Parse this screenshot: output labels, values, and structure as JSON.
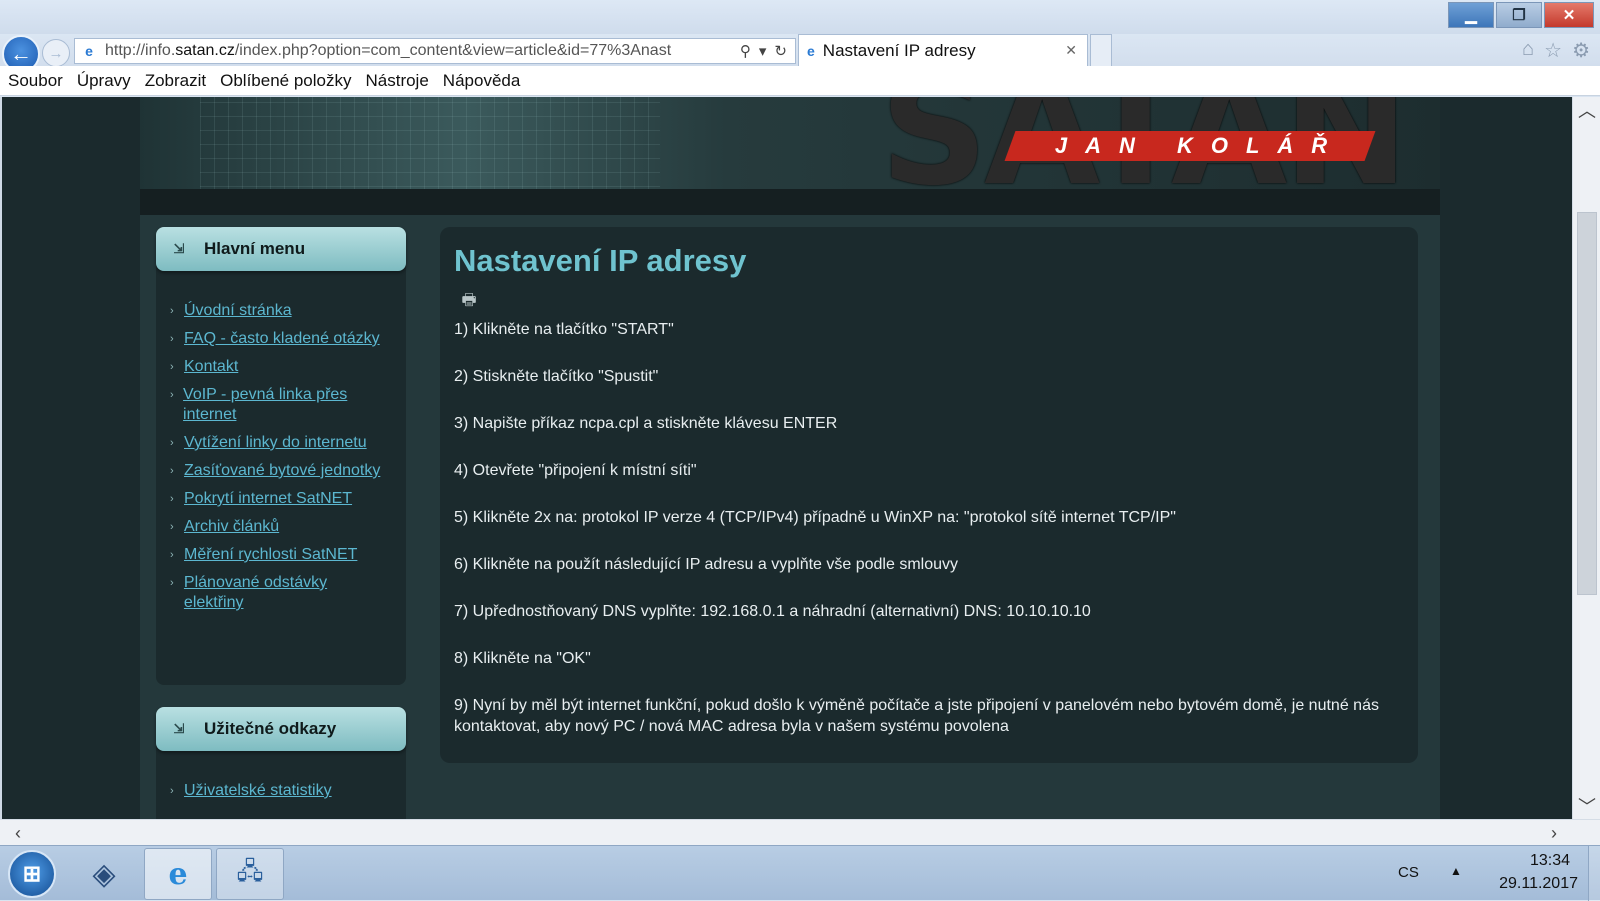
{
  "browser": {
    "url_prefix": "http://info.",
    "url_domain": "satan.cz",
    "url_rest": "/index.php?option=com_content&view=article&id=77%3Anast",
    "tab_title": "Nastavení IP adresy",
    "menu": [
      "Soubor",
      "Úpravy",
      "Zobrazit",
      "Oblíbené položky",
      "Nástroje",
      "Nápověda"
    ]
  },
  "site": {
    "logo_main": "SATAN",
    "logo_sub": "JAN KOLÁŘ"
  },
  "sidebar": {
    "main_menu": {
      "title": "Hlavní menu",
      "items": [
        "Úvodní stránka",
        "FAQ - často kladené otázky",
        "Kontakt",
        "VoIP - pevná linka přes internet",
        "Vytížení linky do internetu",
        "Zasíťované bytové jednotky",
        "Pokrytí internet SatNET",
        "Archiv článků",
        "Měření rychlosti SatNET",
        "Plánované odstávky elektřiny"
      ]
    },
    "useful_links": {
      "title": "Užitečné odkazy",
      "items": [
        "Uživatelské statistiky"
      ]
    }
  },
  "article": {
    "title": "Nastavení IP adresy",
    "steps": [
      "1) Klikněte na tlačítko \"START\"",
      "2) Stiskněte tlačítko \"Spustit\"",
      "3) Napište příkaz ncpa.cpl a stiskněte klávesu ENTER",
      "4) Otevřete \"připojení k místní síti\"",
      "5) Klikněte 2x na: protokol IP verze 4 (TCP/IPv4) případně u WinXP na: \"protokol sítě internet TCP/IP\"",
      "6) Klikněte na použít následující IP adresu a vyplňte vše podle smlouvy",
      "7) Upřednostňovaný DNS vyplňte: 192.168.0.1 a náhradní (alternativní) DNS: 10.10.10.10",
      "8) Klikněte na \"OK\"",
      "9) Nyní by měl být internet funkční, pokud došlo k výměně počítače a jste připojení v panelovém nebo bytovém domě, je nutné nás kontaktovat, aby nový PC / nová MAC adresa byla v našem systému povolena"
    ]
  },
  "taskbar": {
    "language": "CS",
    "time": "13:34",
    "date": "29.11.2017"
  },
  "colors": {
    "accent": "#6fc3cf",
    "link": "#5cb7d0",
    "logo_red": "#c8281e"
  }
}
